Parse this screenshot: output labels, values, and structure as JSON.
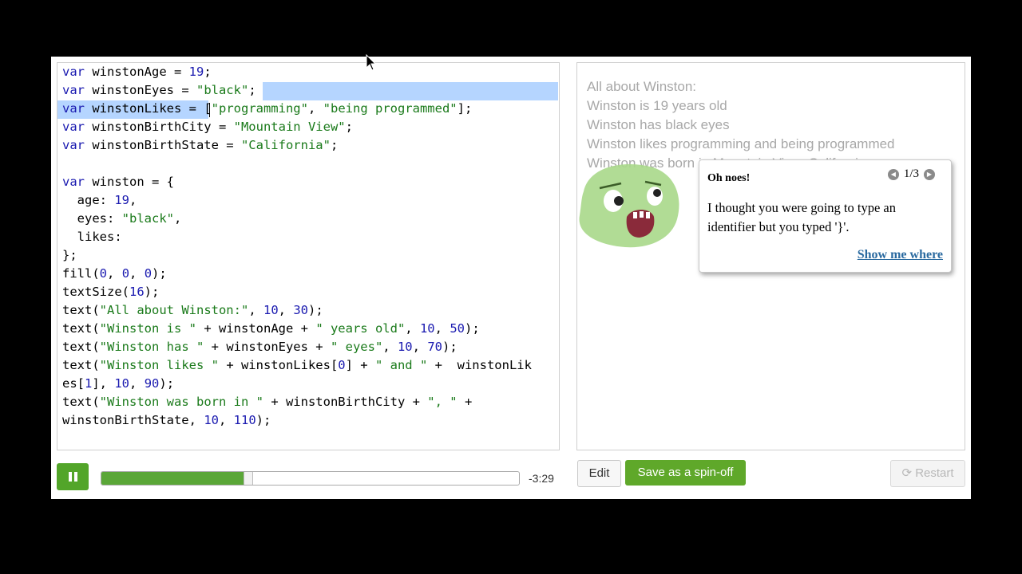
{
  "editor": {
    "lines": [
      [
        {
          "t": "var",
          "c": "k"
        },
        {
          "t": " winstonAge = "
        },
        {
          "t": "19",
          "c": "n"
        },
        {
          "t": ";"
        }
      ],
      [
        {
          "t": "var",
          "c": "k"
        },
        {
          "t": " winstonEyes = "
        },
        {
          "t": "\"black\"",
          "c": "s"
        },
        {
          "t": ";"
        }
      ],
      [
        {
          "t": "var",
          "c": "k"
        },
        {
          "t": " winstonLikes = "
        },
        {
          "t": "[",
          "c": ""
        },
        {
          "t": "\"programming\"",
          "c": "s"
        },
        {
          "t": ", "
        },
        {
          "t": "\"being programmed\"",
          "c": "s"
        },
        {
          "t": "];"
        }
      ],
      [
        {
          "t": "var",
          "c": "k"
        },
        {
          "t": " winstonBirthCity = "
        },
        {
          "t": "\"Mountain View\"",
          "c": "s"
        },
        {
          "t": ";"
        }
      ],
      [
        {
          "t": "var",
          "c": "k"
        },
        {
          "t": " winstonBirthState = "
        },
        {
          "t": "\"California\"",
          "c": "s"
        },
        {
          "t": ";"
        }
      ],
      [],
      [
        {
          "t": "var",
          "c": "k"
        },
        {
          "t": " winston = {"
        }
      ],
      [
        {
          "t": "  age: "
        },
        {
          "t": "19",
          "c": "n"
        },
        {
          "t": ","
        }
      ],
      [
        {
          "t": "  eyes: "
        },
        {
          "t": "\"black\"",
          "c": "s"
        },
        {
          "t": ","
        }
      ],
      [
        {
          "t": "  likes:"
        }
      ],
      [
        {
          "t": "};"
        }
      ],
      [
        {
          "t": "fill("
        },
        {
          "t": "0",
          "c": "n"
        },
        {
          "t": ", "
        },
        {
          "t": "0",
          "c": "n"
        },
        {
          "t": ", "
        },
        {
          "t": "0",
          "c": "n"
        },
        {
          "t": ");"
        }
      ],
      [
        {
          "t": "textSize("
        },
        {
          "t": "16",
          "c": "n"
        },
        {
          "t": ");"
        }
      ],
      [
        {
          "t": "text("
        },
        {
          "t": "\"All about Winston:\"",
          "c": "s"
        },
        {
          "t": ", "
        },
        {
          "t": "10",
          "c": "n"
        },
        {
          "t": ", "
        },
        {
          "t": "30",
          "c": "n"
        },
        {
          "t": ");"
        }
      ],
      [
        {
          "t": "text("
        },
        {
          "t": "\"Winston is \"",
          "c": "s"
        },
        {
          "t": " + winstonAge + "
        },
        {
          "t": "\" years old\"",
          "c": "s"
        },
        {
          "t": ", "
        },
        {
          "t": "10",
          "c": "n"
        },
        {
          "t": ", "
        },
        {
          "t": "50",
          "c": "n"
        },
        {
          "t": ");"
        }
      ],
      [
        {
          "t": "text("
        },
        {
          "t": "\"Winston has \"",
          "c": "s"
        },
        {
          "t": " + winstonEyes + "
        },
        {
          "t": "\" eyes\"",
          "c": "s"
        },
        {
          "t": ", "
        },
        {
          "t": "10",
          "c": "n"
        },
        {
          "t": ", "
        },
        {
          "t": "70",
          "c": "n"
        },
        {
          "t": ");"
        }
      ],
      [
        {
          "t": "text("
        },
        {
          "t": "\"Winston likes \"",
          "c": "s"
        },
        {
          "t": " + winstonLikes["
        },
        {
          "t": "0",
          "c": "n"
        },
        {
          "t": "] + "
        },
        {
          "t": "\" and \"",
          "c": "s"
        },
        {
          "t": " +  winstonLik"
        }
      ],
      [
        {
          "t": "es["
        },
        {
          "t": "1",
          "c": "n"
        },
        {
          "t": "], "
        },
        {
          "t": "10",
          "c": "n"
        },
        {
          "t": ", "
        },
        {
          "t": "90",
          "c": "n"
        },
        {
          "t": ");"
        }
      ],
      [
        {
          "t": "text("
        },
        {
          "t": "\"Winston was born in \"",
          "c": "s"
        },
        {
          "t": " + winstonBirthCity + "
        },
        {
          "t": "\", \"",
          "c": "s"
        },
        {
          "t": " +"
        }
      ],
      [
        {
          "t": "winstonBirthState, "
        },
        {
          "t": "10",
          "c": "n"
        },
        {
          "t": ", "
        },
        {
          "t": "110",
          "c": "n"
        },
        {
          "t": ");"
        }
      ]
    ]
  },
  "output": {
    "lines": [
      "All about Winston:",
      "Winston is 19 years old",
      "Winston has black eyes",
      "Winston likes programming and being programmed",
      "Winston was born in Mountain View, California"
    ]
  },
  "error_bubble": {
    "title": "Oh noes!",
    "pager": "1/3",
    "message": "I thought you were going to type an identifier but you typed '}'.",
    "link": "Show me where"
  },
  "controls": {
    "time_remaining": "-3:29",
    "progress": 0.35,
    "edit_label": "Edit",
    "spinoff_label": "Save as a spin-off",
    "restart_label": "Restart"
  },
  "colors": {
    "accent_green": "#5fa82a",
    "winston_green": "#9fd07a",
    "link_blue": "#2a6aa0"
  }
}
